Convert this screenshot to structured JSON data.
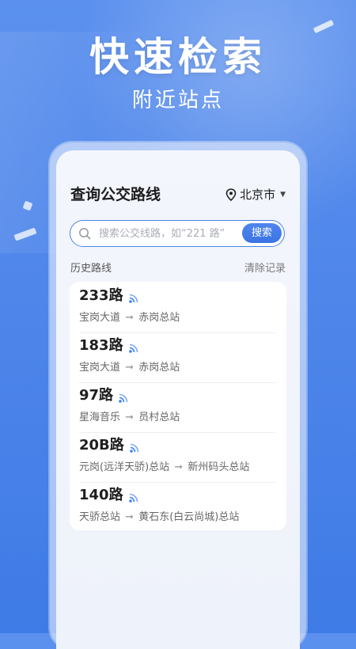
{
  "promo": {
    "title": "快速检索",
    "subtitle": "附近站点"
  },
  "header": {
    "title": "查询公交路线",
    "city": "北京市"
  },
  "search": {
    "placeholder": "搜索公交线路，如“221 路”",
    "button_label": "搜索"
  },
  "history": {
    "label": "历史路线",
    "clear_label": "清除记录",
    "items": [
      {
        "route": "233路",
        "from": "宝岗大道",
        "to": "赤岗总站"
      },
      {
        "route": "183路",
        "from": "宝岗大道",
        "to": "赤岗总站"
      },
      {
        "route": "97路",
        "from": "星海音乐",
        "to": "员村总站"
      },
      {
        "route": "20B路",
        "from": "元岗(远洋天骄)总站",
        "to": "新州码头总站"
      },
      {
        "route": "140路",
        "from": "天骄总站",
        "to": "黄石东(白云尚城)总站"
      }
    ],
    "arrow": "➞"
  },
  "colors": {
    "accent": "#3b74e3",
    "background": "#4f86ea",
    "signal": "#3b82f6"
  },
  "icons": {
    "location": "location-pin-icon",
    "dropdown": "caret-down-icon",
    "search": "search-icon",
    "realtime": "realtime-signal-icon"
  }
}
